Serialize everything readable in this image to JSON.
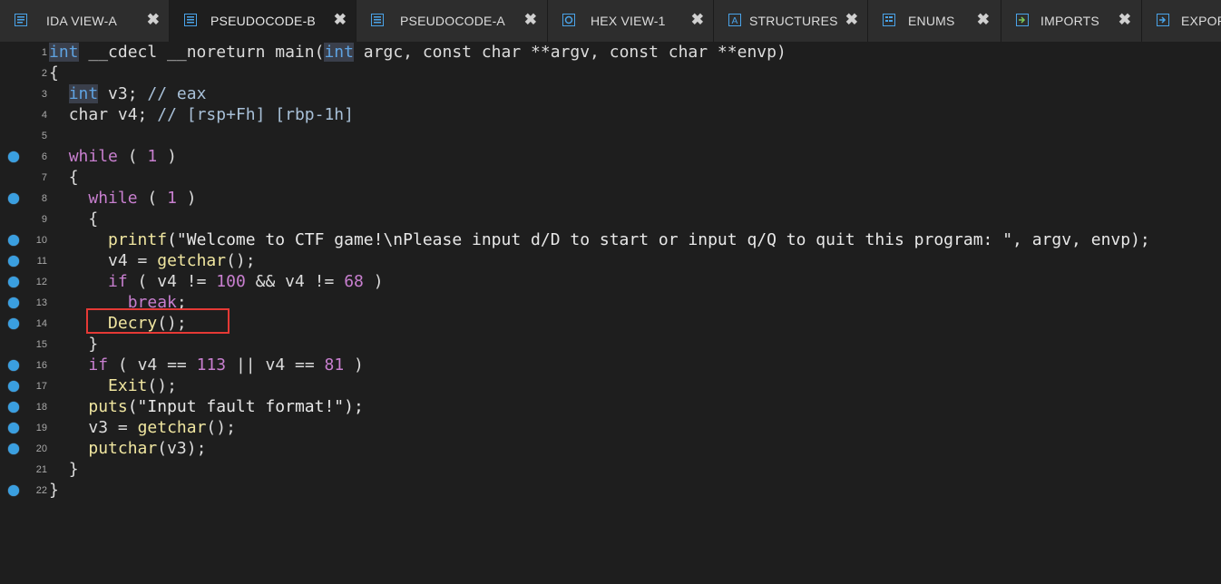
{
  "tabs": [
    {
      "label": "IDA VIEW-A",
      "icon": "ida-view-icon",
      "active": false
    },
    {
      "label": "PSEUDOCODE-B",
      "icon": "pseudocode-icon",
      "active": true
    },
    {
      "label": "PSEUDOCODE-A",
      "icon": "pseudocode-icon",
      "active": false
    },
    {
      "label": "HEX VIEW-1",
      "icon": "hex-view-icon",
      "active": false
    },
    {
      "label": "STRUCTURES",
      "icon": "structures-icon",
      "active": false
    },
    {
      "label": "ENUMS",
      "icon": "enums-icon",
      "active": false
    },
    {
      "label": "IMPORTS",
      "icon": "imports-icon",
      "active": false
    },
    {
      "label": "EXPORTS",
      "icon": "exports-icon",
      "active": false
    }
  ],
  "close_glyph": "✖",
  "code": {
    "line_numbers": [
      "1",
      "2",
      "3",
      "4",
      "5",
      "6",
      "7",
      "8",
      "9",
      "10",
      "11",
      "12",
      "13",
      "14",
      "15",
      "16",
      "17",
      "18",
      "19",
      "20",
      "21",
      "22"
    ],
    "breakpoint_lines": [
      "6",
      "8",
      "10",
      "11",
      "12",
      "13",
      "14",
      "16",
      "17",
      "18",
      "19",
      "20",
      "22"
    ],
    "tokens": {
      "l1_int": "int",
      "l1_rest1": " __cdecl __noreturn main(",
      "l1_int2": "int",
      "l1_rest2": " argc, const char **argv, const char **envp)",
      "l2": "{",
      "l3_int": "int",
      "l3_var": " v3;",
      "l3_cmt": " // eax",
      "l4_char": "char",
      "l4_var": " v4;",
      "l4_cmt": " // [rsp+Fh] [rbp-1h]",
      "l6_kw": "while",
      "l6_open": " ( ",
      "l6_num": "1",
      "l6_close": " )",
      "l7": "{",
      "l8_kw": "while",
      "l8_open": " ( ",
      "l8_num": "1",
      "l8_close": " )",
      "l9": "{",
      "l10_fn": "printf",
      "l10_str": "(\"Welcome to CTF game!\\nPlease input d/D to start or input q/Q to quit this program: \", argv, envp);",
      "l11_var": "v4",
      "l11_eq": " = ",
      "l11_fn": "getchar",
      "l11_end": "();",
      "l12_kw": "if",
      "l12_a": " ( ",
      "l12_v1": "v4",
      "l12_b": " != ",
      "l12_n1": "100",
      "l12_c": " && ",
      "l12_v2": "v4",
      "l12_d": " != ",
      "l12_n2": "68",
      "l12_e": " )",
      "l13_kw": "break",
      "l13_end": ";",
      "l14_fn": "Decry",
      "l14_end": "();",
      "l15": "}",
      "l16_kw": "if",
      "l16_a": " ( ",
      "l16_v1": "v4",
      "l16_b": " == ",
      "l16_n1": "113",
      "l16_c": " || ",
      "l16_v2": "v4",
      "l16_d": " == ",
      "l16_n2": "81",
      "l16_e": " )",
      "l17_fn": "Exit",
      "l17_end": "();",
      "l18_fn": "puts",
      "l18_str": "(\"Input fault format!\");",
      "l19_var": "v3",
      "l19_eq": " = ",
      "l19_fn": "getchar",
      "l19_end": "();",
      "l20_fn": "putchar",
      "l20_a": "(",
      "l20_var": "v3",
      "l20_end": ");",
      "l21": "}",
      "l22": "}"
    }
  },
  "colors": {
    "background": "#1e1e1e",
    "tab_bar": "#2d2d2d",
    "keyword": "#c87fcf",
    "type": "#5fa3e2",
    "function": "#f0e6a0",
    "breakpoint": "#3a9fe0",
    "highlight_box": "#e53935"
  }
}
